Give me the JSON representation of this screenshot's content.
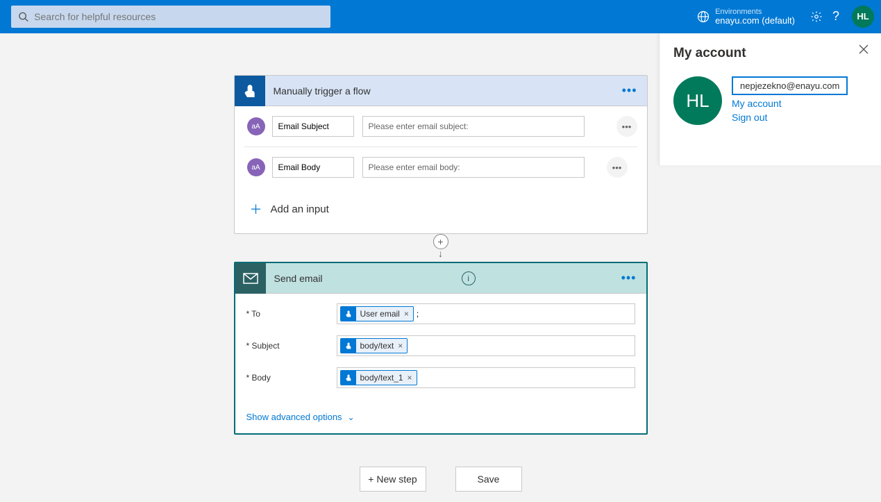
{
  "header": {
    "search_placeholder": "Search for helpful resources",
    "env_label": "Environments",
    "env_name": "enayu.com (default)",
    "avatar_initials": "HL"
  },
  "trigger": {
    "title": "Manually trigger a flow",
    "inputs": [
      {
        "type_badge": "aA",
        "label": "Email Subject",
        "placeholder": "Please enter email subject:"
      },
      {
        "type_badge": "aA",
        "label": "Email Body",
        "placeholder": "Please enter email body:"
      }
    ],
    "add_input_label": "Add an input"
  },
  "action": {
    "title": "Send email",
    "fields": {
      "to": {
        "label": "* To",
        "tokens": [
          "User email"
        ],
        "trailing_text": ";"
      },
      "subject": {
        "label": "* Subject",
        "tokens": [
          "body/text"
        ]
      },
      "body": {
        "label": "* Body",
        "tokens": [
          "body/text_1"
        ]
      }
    },
    "advanced_label": "Show advanced options"
  },
  "buttons": {
    "new_step": "+ New step",
    "save": "Save"
  },
  "flyout": {
    "title": "My account",
    "avatar_initials": "HL",
    "email": "nepjezekno@enayu.com",
    "my_account": "My account",
    "sign_out": "Sign out"
  }
}
